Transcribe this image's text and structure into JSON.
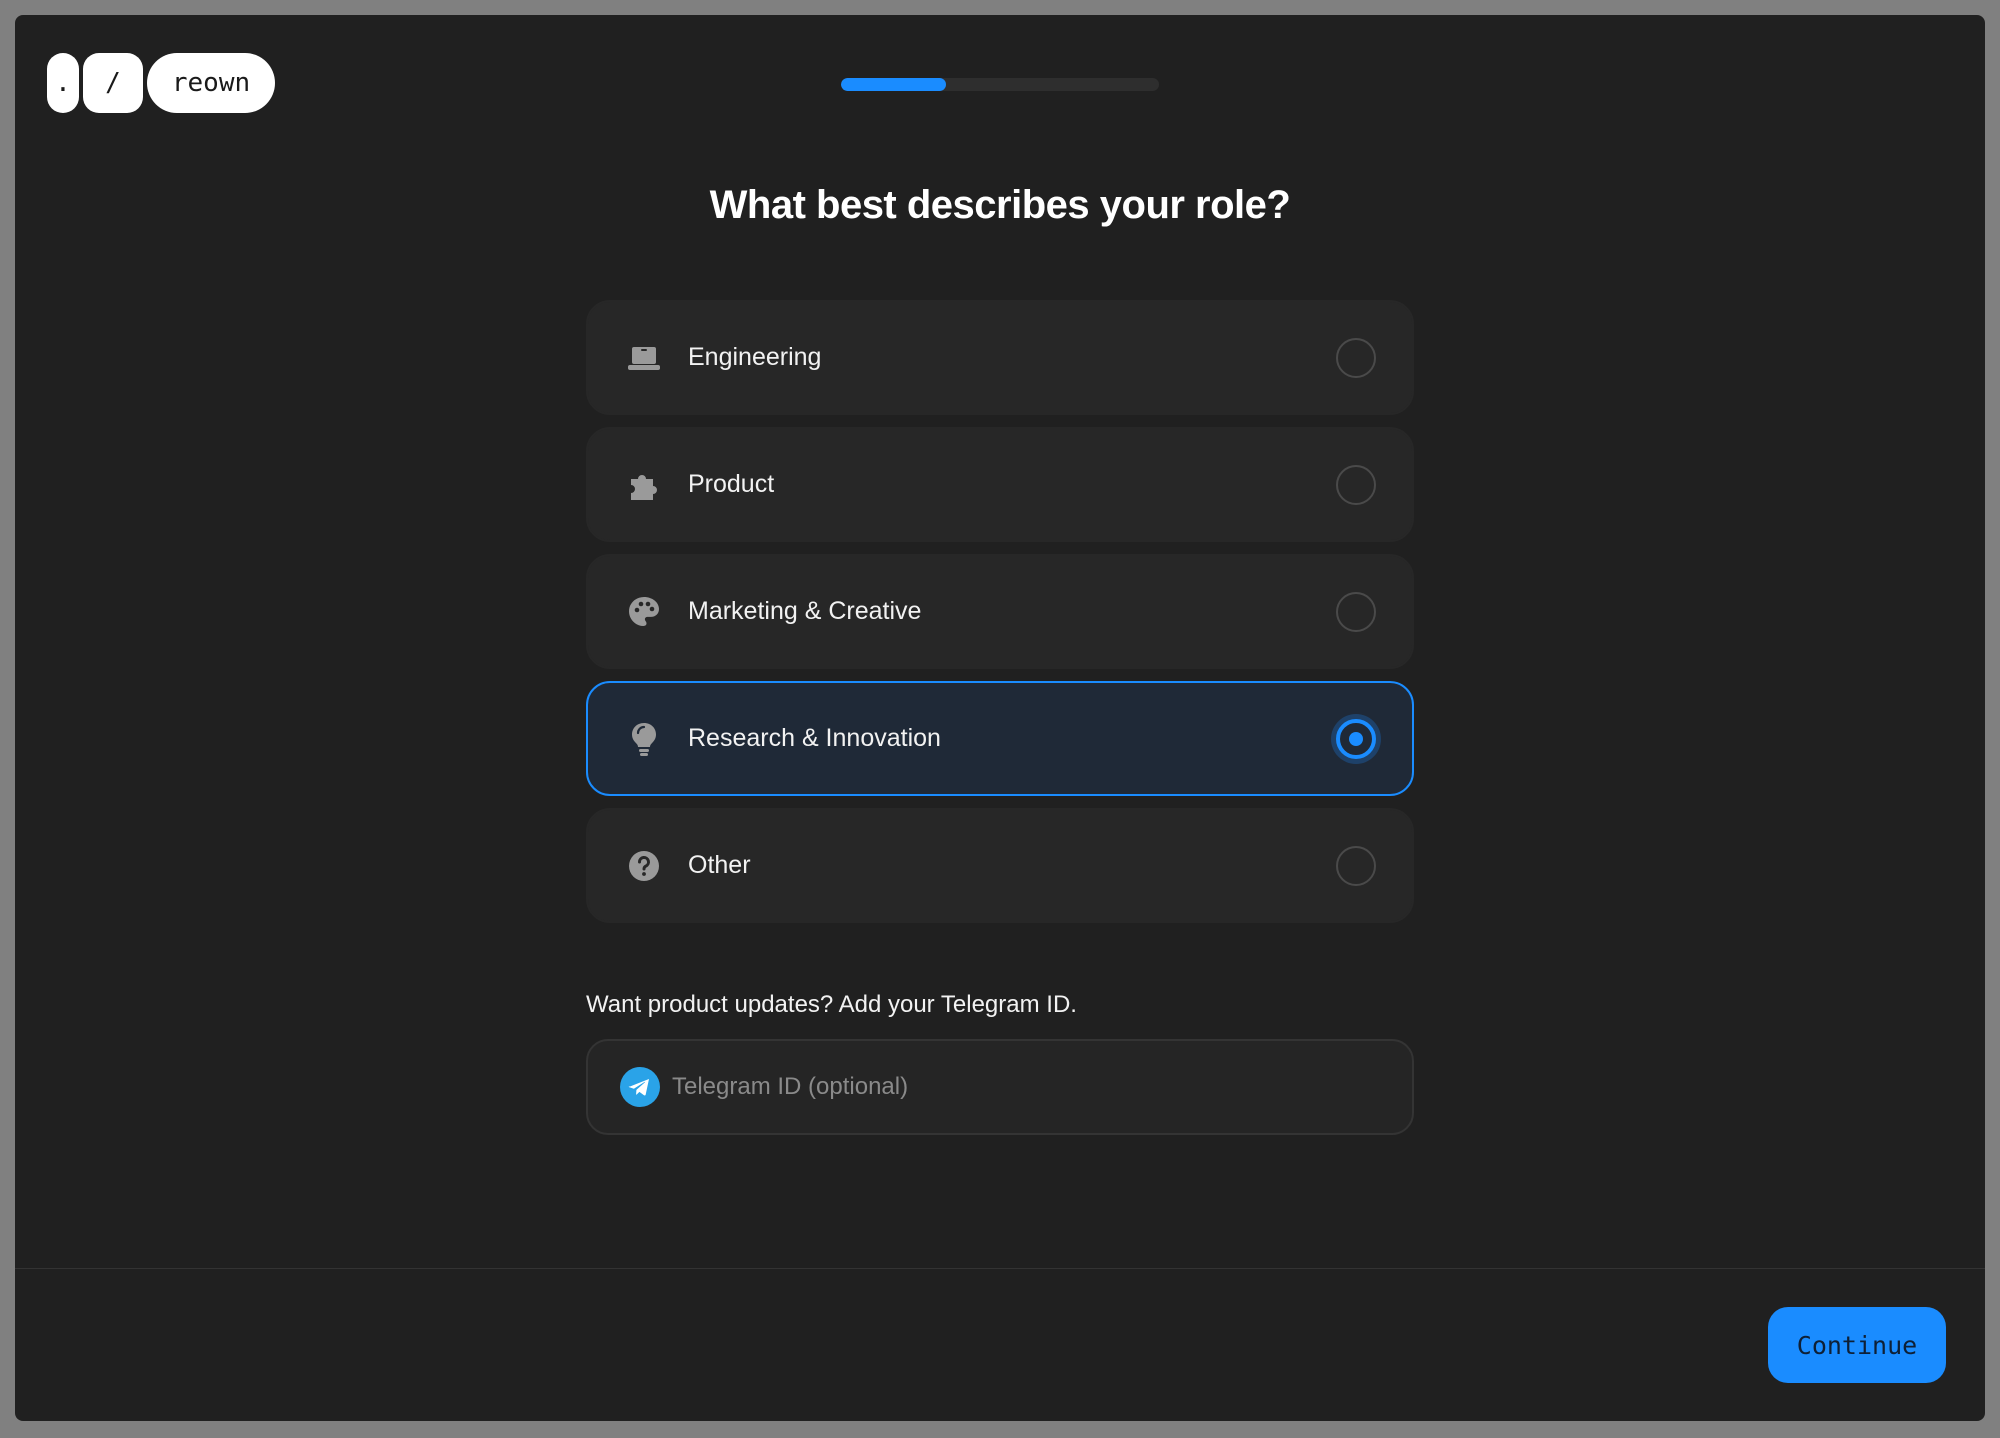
{
  "logo": {
    "dot": ".",
    "slash": "/",
    "word": "reown"
  },
  "progress": {
    "fraction": 0.33,
    "color": "#1a8cff"
  },
  "title": "What best describes your role?",
  "options": [
    {
      "label": "Engineering",
      "icon": "laptop-icon",
      "selected": false
    },
    {
      "label": "Product",
      "icon": "puzzle-icon",
      "selected": false
    },
    {
      "label": "Marketing & Creative",
      "icon": "palette-icon",
      "selected": false
    },
    {
      "label": "Research & Innovation",
      "icon": "lightbulb-icon",
      "selected": true
    },
    {
      "label": "Other",
      "icon": "question-circle-icon",
      "selected": false
    }
  ],
  "telegram": {
    "label": "Want product updates? Add your Telegram ID.",
    "placeholder": "Telegram ID (optional)",
    "value": "",
    "icon": "telegram-icon"
  },
  "footer": {
    "continue_label": "Continue"
  },
  "colors": {
    "accent": "#1a8cff",
    "background": "#202020",
    "card": "#272727"
  }
}
